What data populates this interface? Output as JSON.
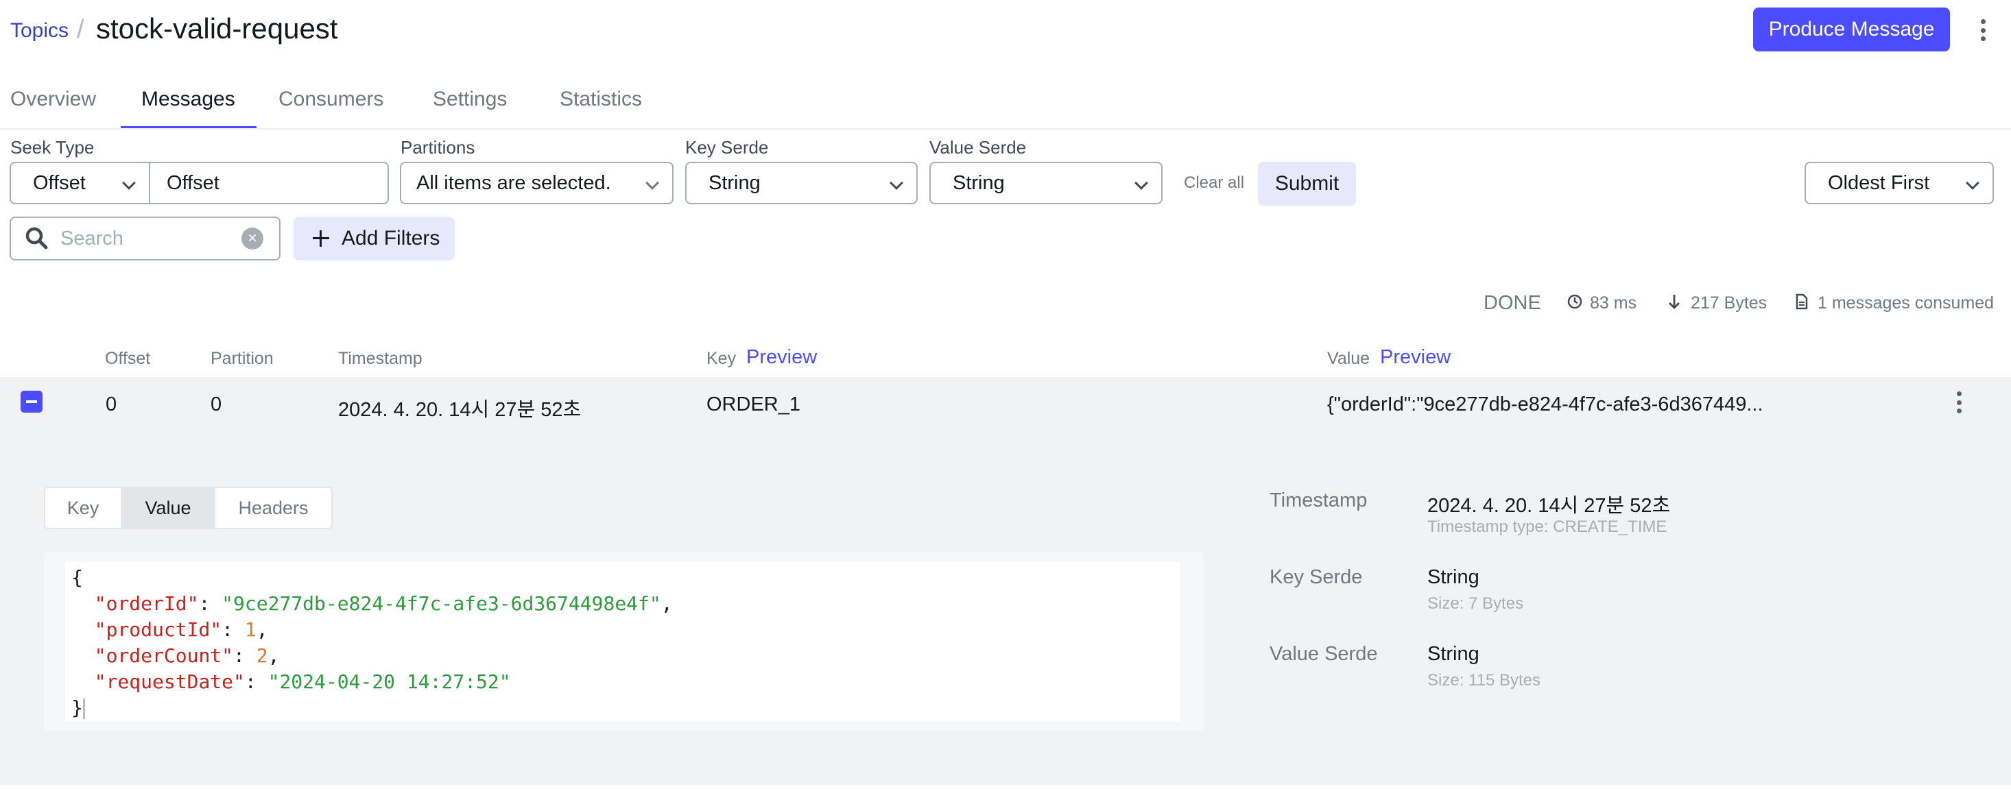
{
  "breadcrumb": {
    "parent": "Topics",
    "separator": "/",
    "current": "stock-valid-request"
  },
  "header": {
    "produce_button": "Produce Message"
  },
  "tabs": [
    "Overview",
    "Messages",
    "Consumers",
    "Settings",
    "Statistics"
  ],
  "active_tab": "Messages",
  "filters": {
    "seek_type": {
      "label": "Seek Type",
      "selected": "Offset",
      "value": "Offset"
    },
    "partitions": {
      "label": "Partitions",
      "selected": "All items are selected."
    },
    "key_serde": {
      "label": "Key Serde",
      "selected": "String"
    },
    "value_serde": {
      "label": "Value Serde",
      "selected": "String"
    },
    "clear_all": "Clear all",
    "submit": "Submit",
    "sort": "Oldest First",
    "search_placeholder": "Search",
    "add_filters": "Add Filters"
  },
  "status": {
    "state": "DONE",
    "elapsed": "83 ms",
    "bytes": "217 Bytes",
    "consumed": "1 messages consumed"
  },
  "table": {
    "columns": {
      "offset": "Offset",
      "partition": "Partition",
      "timestamp": "Timestamp",
      "key": "Key",
      "value": "Value",
      "preview": "Preview"
    },
    "rows": [
      {
        "offset": "0",
        "partition": "0",
        "timestamp": "2024. 4. 20. 14시 27분 52초",
        "key": "ORDER_1",
        "value": "{\"orderId\":\"9ce277db-e824-4f7c-afe3-6d367449..."
      }
    ]
  },
  "detail": {
    "tabs": [
      "Key",
      "Value",
      "Headers"
    ],
    "active_tab": "Value",
    "json_lines": [
      {
        "key": "orderId",
        "value": "\"9ce277db-e824-4f7c-afe3-6d3674498e4f\"",
        "type": "string",
        "comma": ","
      },
      {
        "key": "productId",
        "value": "1",
        "type": "number",
        "comma": ","
      },
      {
        "key": "orderCount",
        "value": "2",
        "type": "number",
        "comma": ","
      },
      {
        "key": "requestDate",
        "value": "\"2024-04-20 14:27:52\"",
        "type": "string",
        "comma": ""
      }
    ],
    "meta": {
      "timestamp_label": "Timestamp",
      "timestamp_value": "2024. 4. 20. 14시 27분 52초",
      "timestamp_type": "Timestamp type: CREATE_TIME",
      "key_serde_label": "Key Serde",
      "key_serde_value": "String",
      "key_size": "Size: 7 Bytes",
      "value_serde_label": "Value Serde",
      "value_serde_value": "String",
      "value_size": "Size: 115 Bytes"
    }
  },
  "icons": {
    "clock": "clock-icon",
    "download": "arrow-down-icon",
    "document": "file-icon",
    "search": "search-icon"
  },
  "colors": {
    "accent": "#4c4cff",
    "link": "#3741c8",
    "json_key": "#c8221f",
    "json_string": "#2e9b3e",
    "json_number": "#e07b24"
  }
}
